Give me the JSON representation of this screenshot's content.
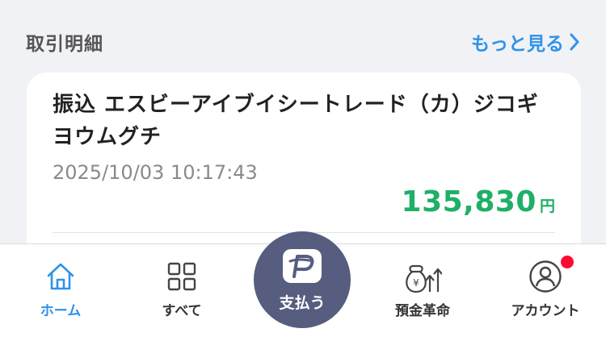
{
  "section": {
    "title": "取引明細",
    "more_label": "もっと見る"
  },
  "transaction": {
    "title": "振込 エスビーアイブイシートレード（カ）ジコギヨウムグチ",
    "datetime": "2025/10/03 10:17:43",
    "amount": "135,830",
    "currency": "円"
  },
  "tabbar": {
    "home": "ホーム",
    "all": "すべて",
    "pay": "支払う",
    "savings": "預金革命",
    "account": "アカウント"
  },
  "colors": {
    "accent": "#2f93e8",
    "amount": "#1fb067",
    "pay_button": "#565d7f",
    "notification": "#ff0a2f"
  }
}
